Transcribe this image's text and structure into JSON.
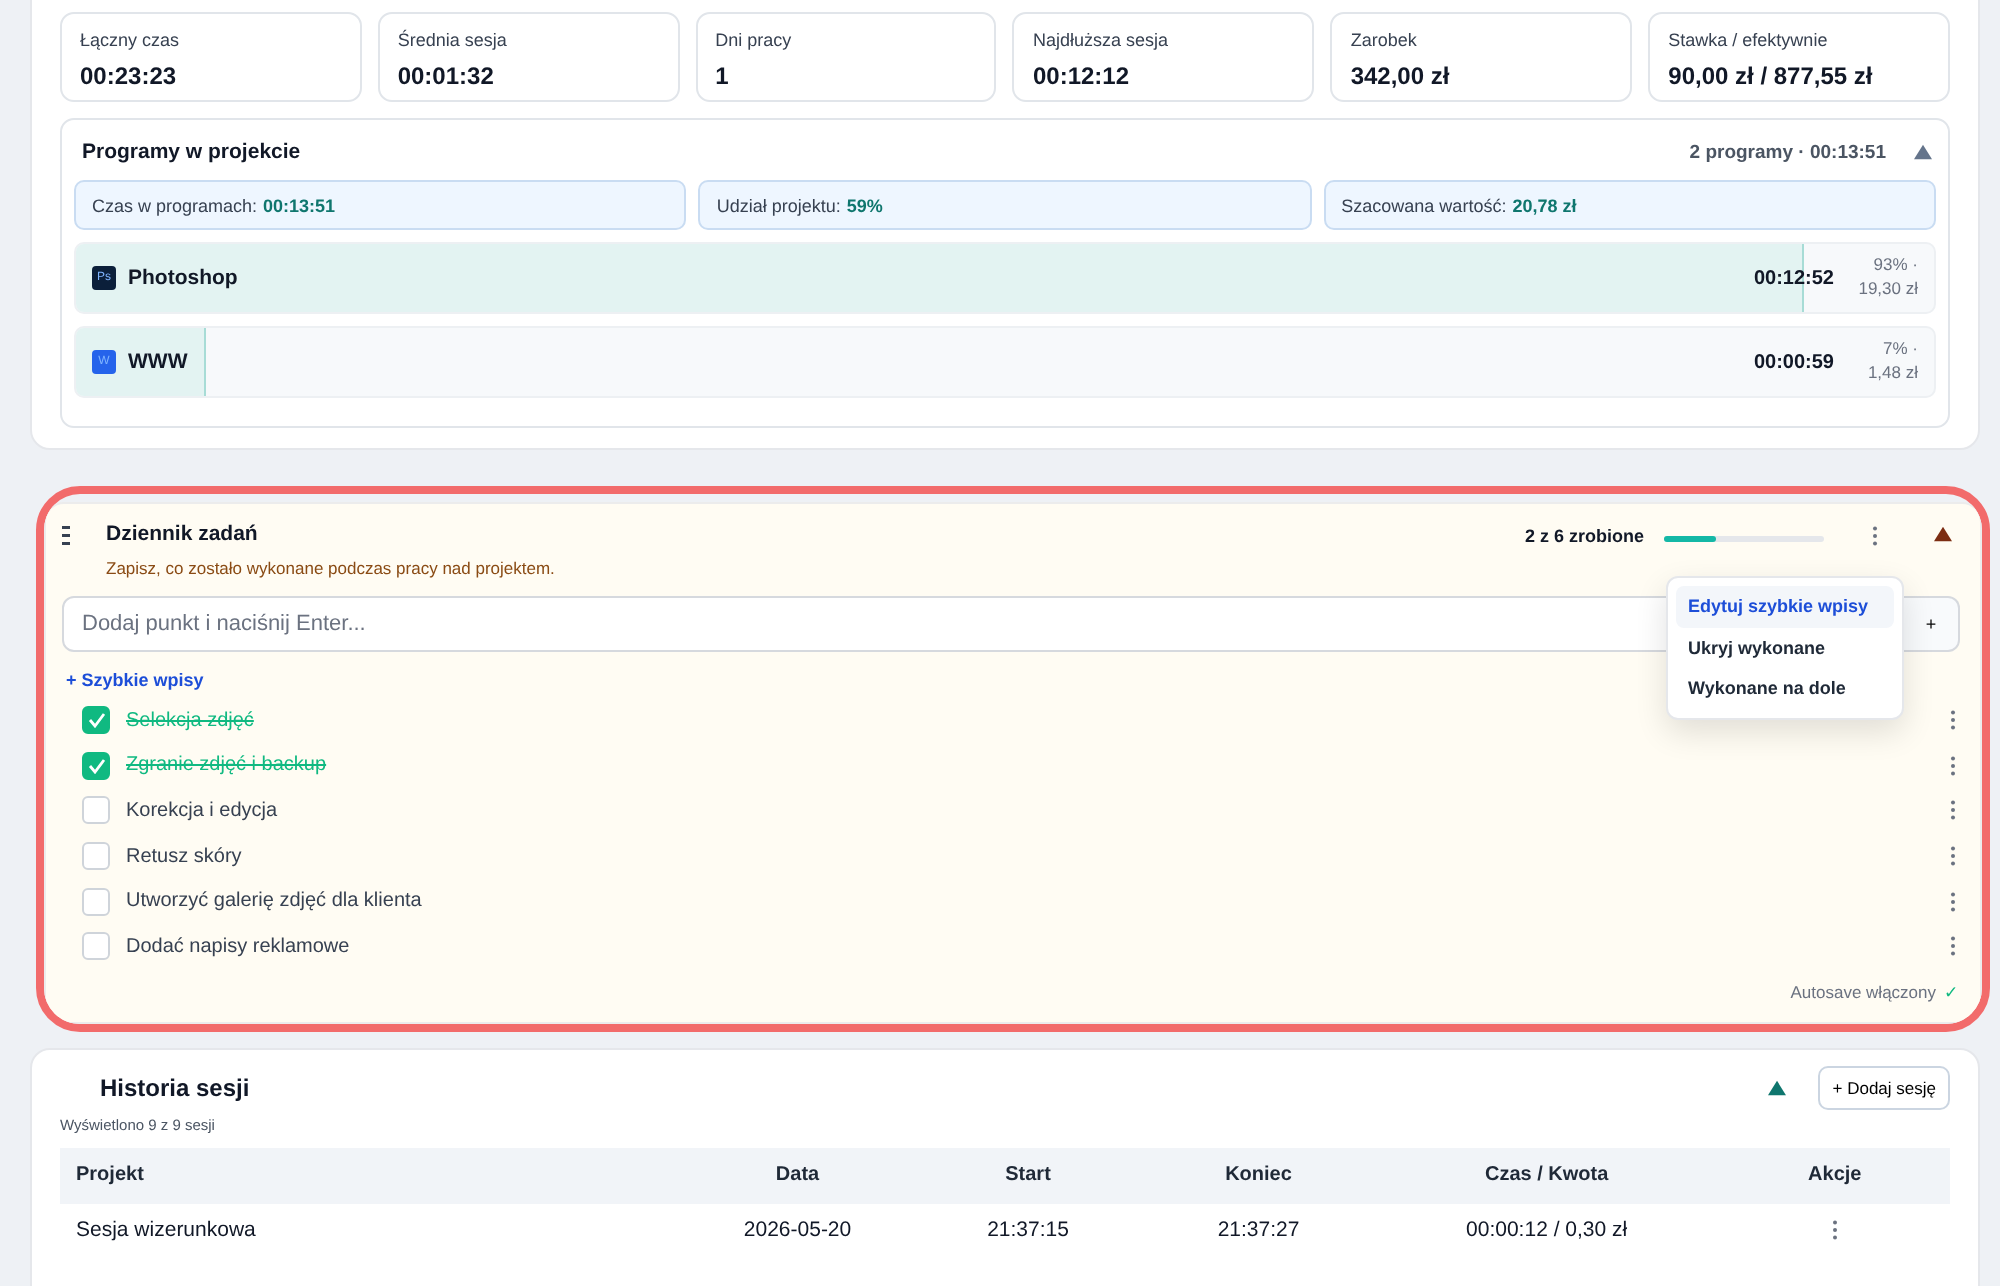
{
  "stats": [
    {
      "label": "Łączny czas",
      "value": "00:23:23"
    },
    {
      "label": "Średnia sesja",
      "value": "00:01:32"
    },
    {
      "label": "Dni pracy",
      "value": "1"
    },
    {
      "label": "Najdłuższa sesja",
      "value": "00:12:12"
    },
    {
      "label": "Zarobek",
      "value": "342,00 zł"
    },
    {
      "label": "Stawka / efektywnie",
      "value": "90,00 zł / 877,55 zł"
    }
  ],
  "programs": {
    "title": "Programy w projekcie",
    "summary": "2 programy · 00:13:51",
    "expanded": true,
    "metrics": [
      {
        "label": "Czas w programach:",
        "value": "00:13:51"
      },
      {
        "label": "Udział projektu:",
        "value": "59%"
      },
      {
        "label": "Szacowana wartość:",
        "value": "20,78 zł"
      }
    ],
    "items": [
      {
        "badge": "Ps",
        "name": "Photoshop",
        "time": "00:12:52",
        "share": "93% ·",
        "amount": "19,30 zł",
        "level": 0.93,
        "color": "#0b1f3a"
      },
      {
        "badge": "W",
        "name": "WWW",
        "time": "00:00:59",
        "share": "7% ·",
        "amount": "1,48 zł",
        "level": 0.07,
        "color": "#2563eb"
      }
    ]
  },
  "task_log": {
    "title": "Dziennik zadań",
    "subtitle": "Zapisz, co zostało wykonane podczas pracy nad projektem.",
    "progress_text": "2 z 6 zrobione",
    "level": 0.33,
    "expanded": true,
    "input": {
      "placeholder": "Dodaj punkt i naciśnij Enter...",
      "add": "+"
    },
    "quick_link": "+ Szybkie wpisy",
    "menu": [
      {
        "label": "Edytuj szybkie wpisy",
        "selected": true
      },
      {
        "label": "Ukryj wykonane",
        "selected": false
      },
      {
        "label": "Wykonane na dole",
        "selected": false
      }
    ],
    "tasks": [
      {
        "label": "Selekcja zdjęć",
        "checked": true
      },
      {
        "label": "Zgranie zdjęć i backup",
        "checked": true
      },
      {
        "label": "Korekcja i edycja",
        "checked": false
      },
      {
        "label": "Retusz skóry",
        "checked": false
      },
      {
        "label": "Utworzyć galerię zdjęć dla klienta",
        "checked": false
      },
      {
        "label": "Dodać napisy reklamowe",
        "checked": false
      }
    ],
    "autosave": "Autosave włączony",
    "autosave_mark": "✓"
  },
  "history": {
    "title": "Historia sesji",
    "expanded": true,
    "add_button": "+ Dodaj sesję",
    "count": "Wyświetlono 9 z 9 sesji",
    "columns": [
      "Projekt",
      "Data",
      "Start",
      "Koniec",
      "Czas / Kwota",
      "Akcje"
    ],
    "rows": [
      [
        "Sesja wizerunkowa",
        "2026-05-20",
        "21:37:15",
        "21:37:27",
        "00:00:12 / 0,30 zł"
      ]
    ]
  }
}
